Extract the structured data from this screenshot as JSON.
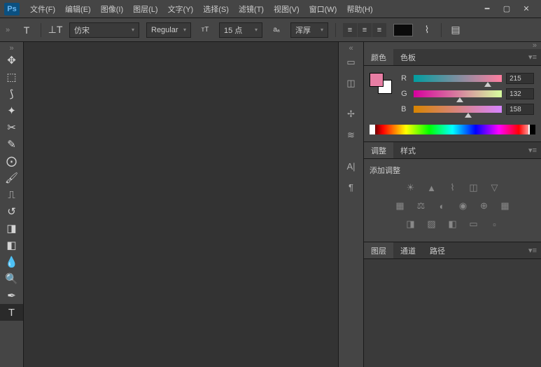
{
  "menubar": {
    "logo": "Ps",
    "items": [
      "文件(F)",
      "编辑(E)",
      "图像(I)",
      "图层(L)",
      "文字(Y)",
      "选择(S)",
      "滤镜(T)",
      "视图(V)",
      "窗口(W)",
      "帮助(H)"
    ]
  },
  "optbar": {
    "font": "仿宋",
    "weight": "Regular",
    "size": "15 点",
    "aa": "浑厚"
  },
  "color_panel": {
    "tab_color": "颜色",
    "tab_swatches": "色板",
    "r_label": "R",
    "r_val": "215",
    "g_label": "G",
    "g_val": "132",
    "b_label": "B",
    "b_val": "158"
  },
  "adjust_panel": {
    "tab_adjust": "调整",
    "tab_styles": "样式",
    "caption": "添加调整"
  },
  "layers_panel": {
    "tab_layers": "图层",
    "tab_channels": "通道",
    "tab_paths": "路径"
  }
}
